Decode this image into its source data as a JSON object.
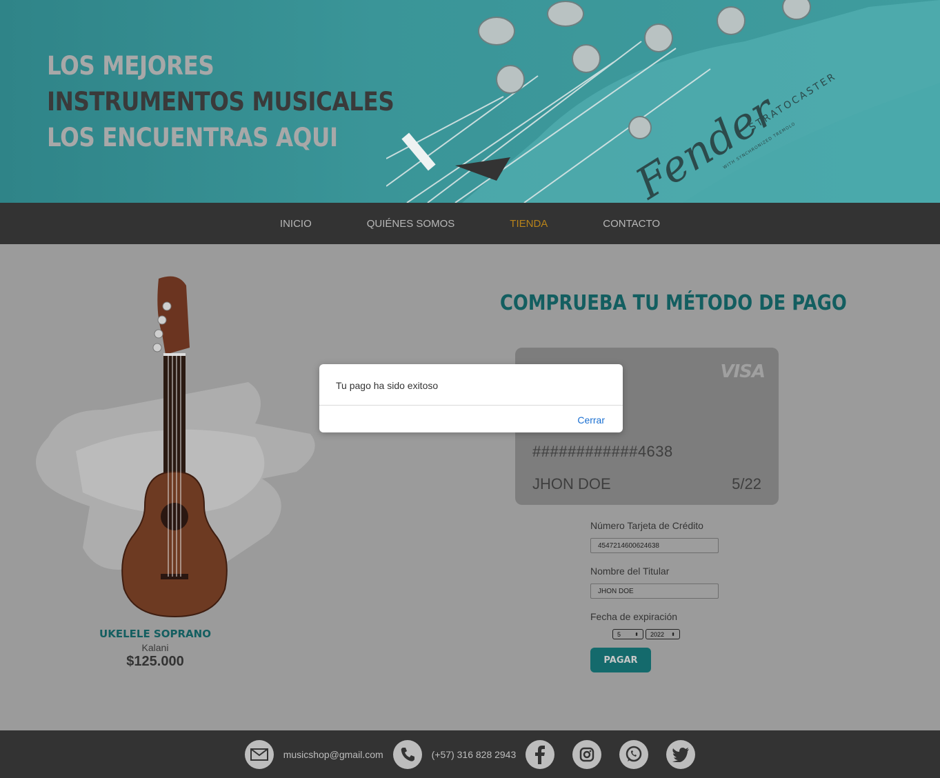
{
  "hero": {
    "line1": "LOS MEJORES",
    "line2": "INSTRUMENTOS MUSICALES",
    "line3": "LOS ENCUENTRAS AQUI",
    "guitar_brand": "Fender",
    "guitar_model": "STRATOCASTER",
    "guitar_sub": "WITH SYNCHRONIZED TREMOLO"
  },
  "nav": {
    "items": [
      {
        "label": "INICIO",
        "active": false
      },
      {
        "label": "QUIÉNES SOMOS",
        "active": false
      },
      {
        "label": "TIENDA",
        "active": true
      },
      {
        "label": "CONTACTO",
        "active": false
      }
    ]
  },
  "product": {
    "name": "UKELELE SOPRANO",
    "brand": "Kalani",
    "price": "$125.000"
  },
  "payment": {
    "title": "COMPRUEBA TU MÉTODO DE PAGO",
    "card": {
      "brand": "VISA",
      "number": "############4638",
      "holder": "JHON DOE",
      "expiry": "5/22"
    },
    "form": {
      "card_label": "Número Tarjeta de Crédito",
      "card_value": "4547214600624638",
      "holder_label": "Nombre del Titular",
      "holder_value": "JHON DOE",
      "expiry_label": "Fecha de expiración",
      "month": "5",
      "year": "2022",
      "submit_label": "PAGAR"
    }
  },
  "footer": {
    "email": "musicshop@gmail.com",
    "phone": "(+57) 316 828 2943"
  },
  "dialog": {
    "message": "Tu pago ha sido exitoso",
    "close_label": "Cerrar"
  },
  "colors": {
    "accent_teal": "#146a6c",
    "nav_active": "#b8831a",
    "nav_bg": "#333333",
    "dialog_link": "#1a6fd1"
  }
}
